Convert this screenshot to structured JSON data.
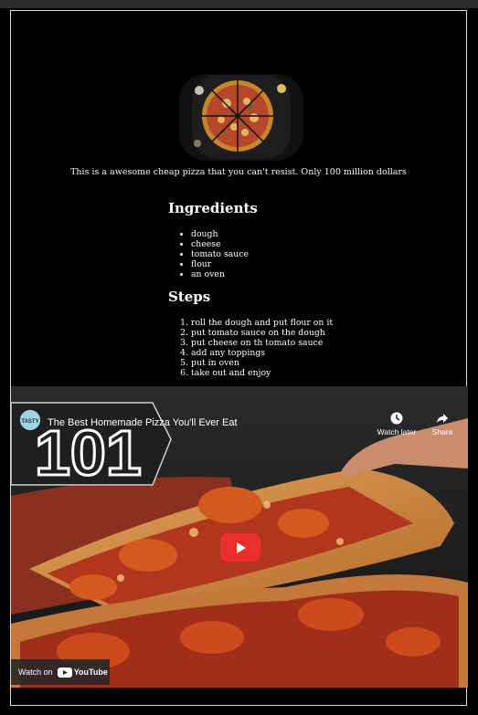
{
  "article": {
    "caption": "This is a awesome cheap pizza that you can't resist. Only 100 million dollars",
    "ingredients_heading": "Ingredients",
    "ingredients": [
      "dough",
      "cheese",
      "tomato sauce",
      "flour",
      "an oven"
    ],
    "steps_heading": "Steps",
    "steps": [
      "roll the dough and put flour on it",
      "put tomato sauce on the dough",
      "put cheese on th tomato sauce",
      "add any toppings",
      "put in oven",
      "take out and enjoy"
    ]
  },
  "video": {
    "title": "The Best Homemade Pizza You'll Ever Eat",
    "badge_text": "101",
    "channel_logo": "TASTY",
    "watch_later": "Watch later",
    "share": "Share",
    "watch_on": "Watch on",
    "platform": "YouTube",
    "play_color": "#ea2f2f"
  },
  "icons": {
    "clock": "clock-icon",
    "share": "share-icon",
    "play": "play-icon"
  }
}
